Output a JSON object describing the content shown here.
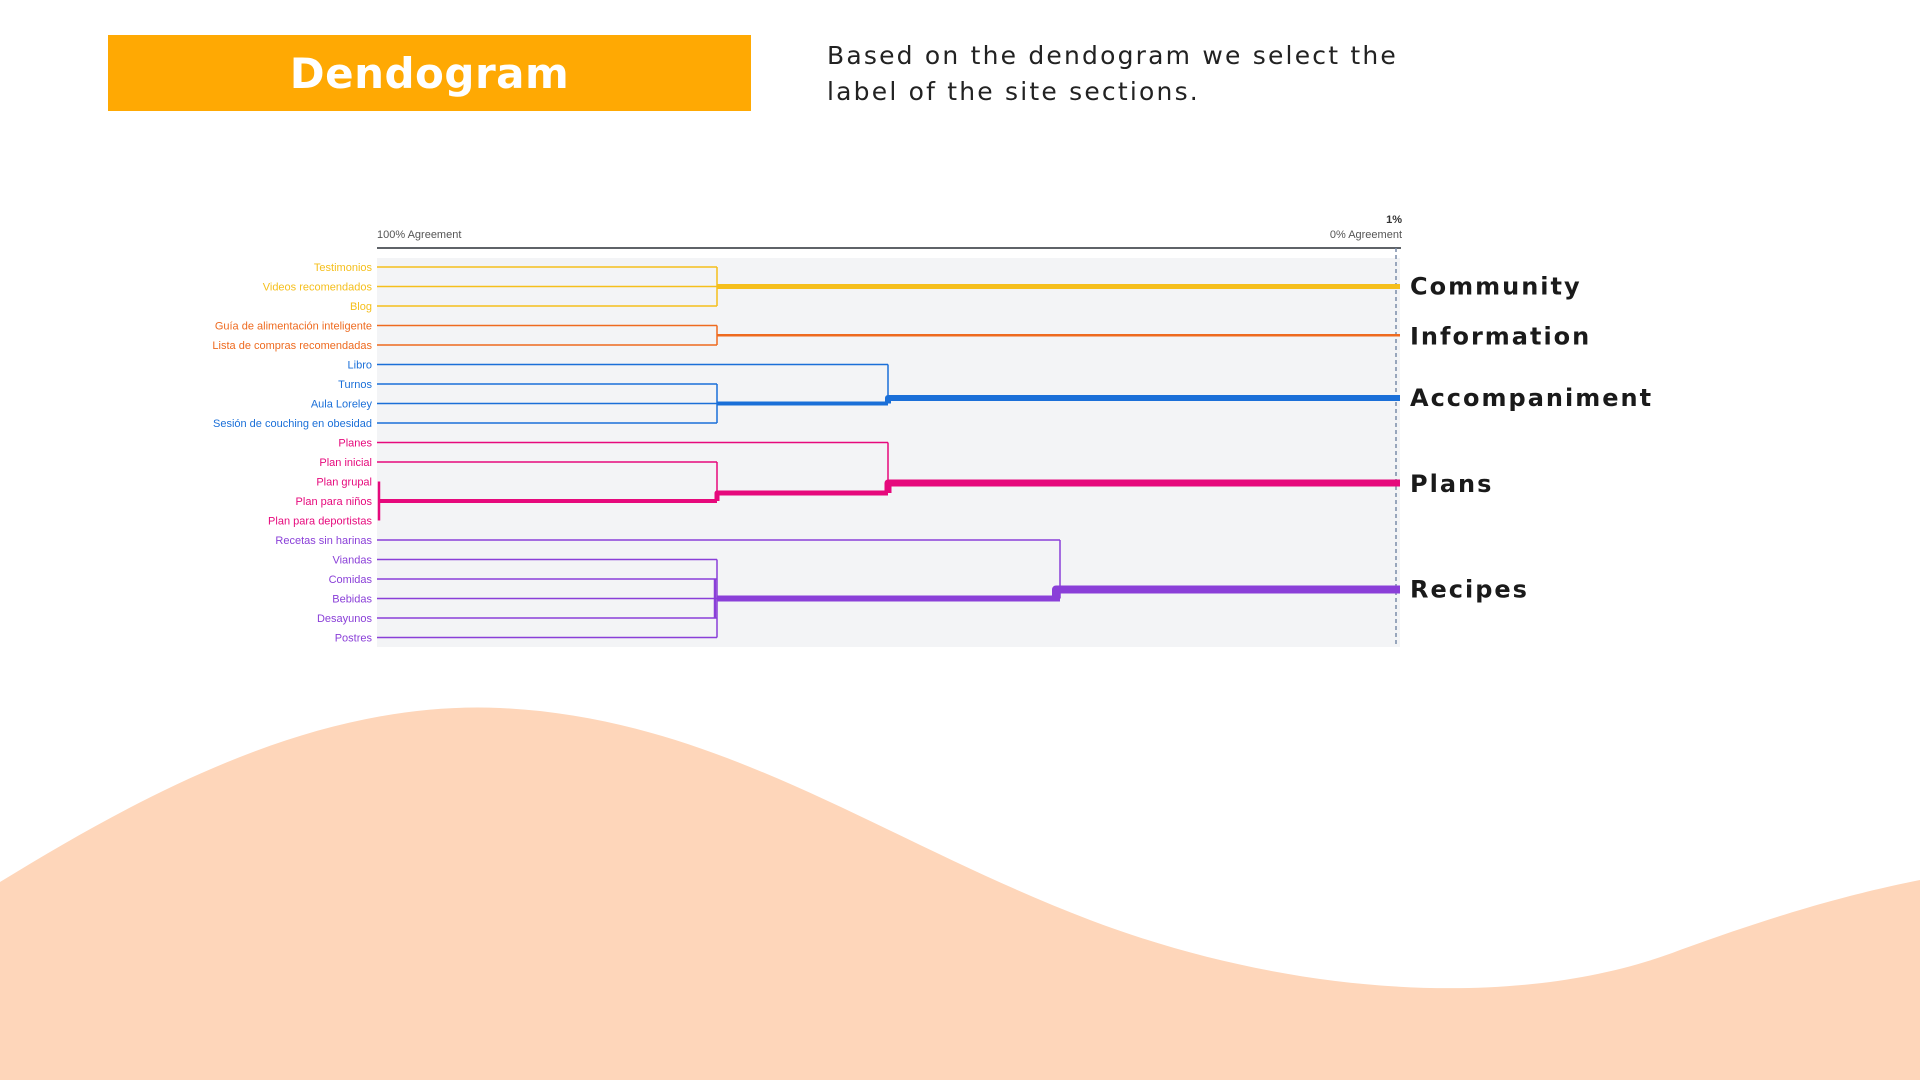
{
  "slide": {
    "title": "Dendogram",
    "description": "Based on the dendogram we select the label of the site sections."
  },
  "colors": {
    "banner": "#ffa903",
    "wave": "#fed6ba",
    "panel": "#f3f4f6",
    "community": "#f5bf1c",
    "information": "#ee6a1f",
    "accompaniment": "#1a6fd8",
    "plans": "#e6097c",
    "recipes": "#8a3fd8"
  },
  "chart_data": {
    "type": "dendrogram",
    "axis": {
      "left_label": "100% Agreement",
      "right_label": "0% Agreement",
      "right_top_label": "1%"
    },
    "leaves": [
      {
        "label": "Testimonios",
        "group": "community"
      },
      {
        "label": "Videos recomendados",
        "group": "community"
      },
      {
        "label": "Blog",
        "group": "community"
      },
      {
        "label": "Guía de alimentación inteligente",
        "group": "information"
      },
      {
        "label": "Lista de compras recomendadas",
        "group": "information"
      },
      {
        "label": "Libro",
        "group": "accompaniment"
      },
      {
        "label": "Turnos",
        "group": "accompaniment"
      },
      {
        "label": "Aula Loreley",
        "group": "accompaniment"
      },
      {
        "label": "Sesión de couching en obesidad",
        "group": "accompaniment"
      },
      {
        "label": "Planes",
        "group": "plans"
      },
      {
        "label": "Plan inicial",
        "group": "plans"
      },
      {
        "label": "Plan grupal",
        "group": "plans"
      },
      {
        "label": "Plan para niños",
        "group": "plans"
      },
      {
        "label": "Plan para deportistas",
        "group": "plans"
      },
      {
        "label": "Recetas sin harinas",
        "group": "recipes"
      },
      {
        "label": "Viandas",
        "group": "recipes"
      },
      {
        "label": "Comidas",
        "group": "recipes"
      },
      {
        "label": "Bebidas",
        "group": "recipes"
      },
      {
        "label": "Desayunos",
        "group": "recipes"
      },
      {
        "label": "Postres",
        "group": "recipes"
      }
    ],
    "groups": [
      {
        "id": "community",
        "label": "Community",
        "color": "#f5bf1c"
      },
      {
        "id": "information",
        "label": "Information",
        "color": "#ee6a1f"
      },
      {
        "id": "accompaniment",
        "label": "Accompaniment",
        "color": "#1a6fd8"
      },
      {
        "id": "plans",
        "label": "Plans",
        "color": "#e6097c"
      },
      {
        "id": "recipes",
        "label": "Recipes",
        "color": "#8a3fd8"
      }
    ]
  }
}
